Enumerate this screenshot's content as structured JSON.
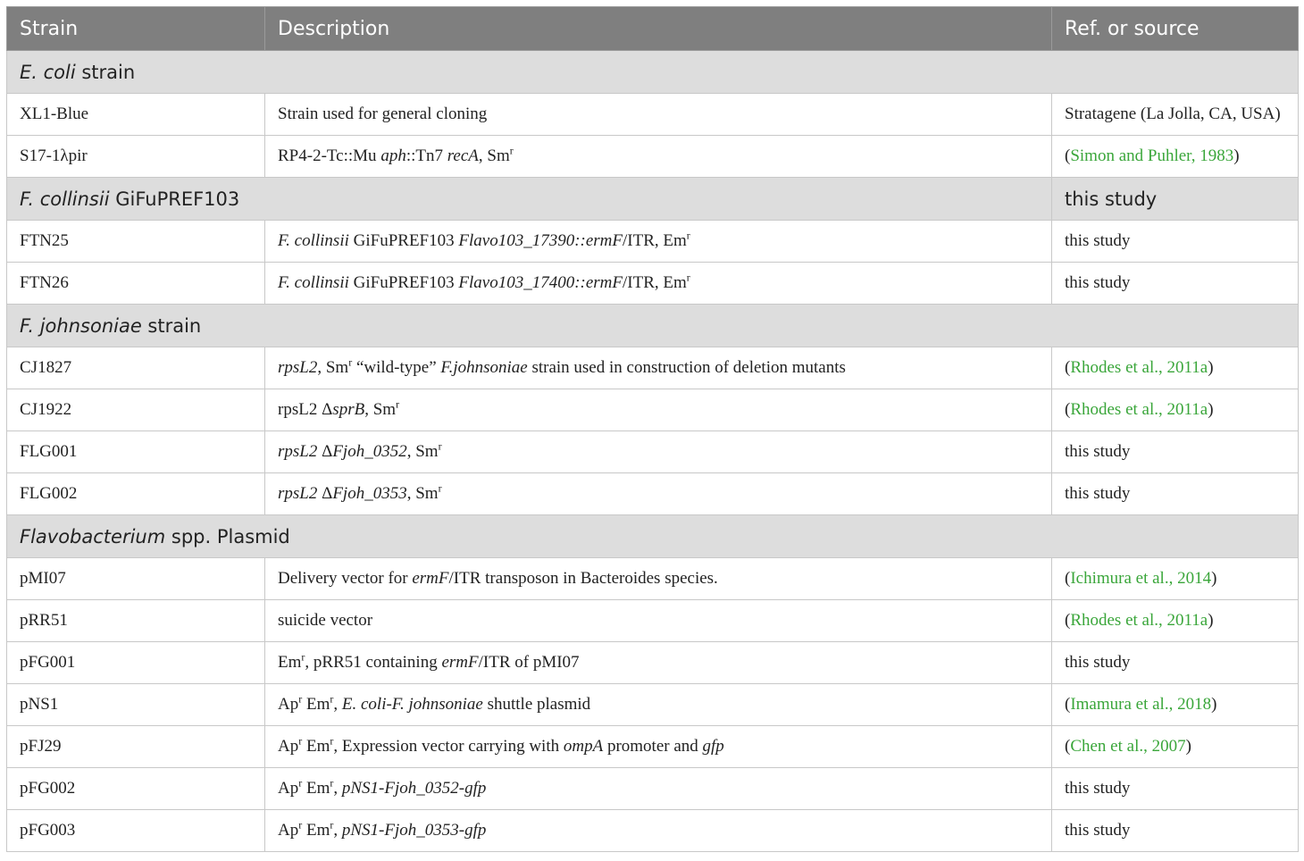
{
  "header": {
    "strain": "Strain",
    "description": "Description",
    "ref": "Ref. or source"
  },
  "sections": {
    "ecoli": {
      "italic": "E. coli",
      "rest": " strain"
    },
    "fcollinsii": {
      "italic": "F. collinsii",
      "rest": " GiFuPREF103",
      "ref": "this study"
    },
    "fjohnsoniae": {
      "italic": "F. johnsoniae",
      "rest": " strain"
    },
    "flavo": {
      "italic": "Flavobacterium",
      "rest": " spp. Plasmid"
    }
  },
  "sup_r": "r",
  "rows": {
    "xl1": {
      "strain": "XL1-Blue",
      "desc": "Strain used for general cloning",
      "ref": "Stratagene (La Jolla, CA, USA)"
    },
    "s17": {
      "strain": "S17-1λpir",
      "d1": "RP4-2-Tc::Mu ",
      "d2": "aph",
      "d3": "::Tn7 ",
      "d4": "recA",
      "d5": ", Sm",
      "ref_open": "(",
      "ref_link": "Simon and Puhler, 1983",
      "ref_close": ")"
    },
    "ftn25": {
      "strain": "FTN25",
      "d1": "F. collinsii",
      "d2": " GiFuPREF103 ",
      "d3": "Flavo103_17390::ermF",
      "d4": "/ITR, Em",
      "ref": "this study"
    },
    "ftn26": {
      "strain": "FTN26",
      "d1": "F. collinsii",
      "d2": " GiFuPREF103 ",
      "d3": "Flavo103_17400::ermF",
      "d4": "/ITR, Em",
      "ref": "this study"
    },
    "cj1827": {
      "strain": "CJ1827",
      "d1": "rpsL2",
      "d2": ", Sm",
      "d3": " “wild-type” ",
      "d4": "F.johnsoniae",
      "d5": " strain used in construction of deletion mutants",
      "ref_open": "(",
      "ref_link": "Rhodes et al., 2011a",
      "ref_close": ")"
    },
    "cj1922": {
      "strain": "CJ1922",
      "d1": "rpsL2 Δ",
      "d2": "sprB",
      "d3": ", Sm",
      "ref_open": "(",
      "ref_link": "Rhodes et al., 2011a",
      "ref_close": ")"
    },
    "flg001": {
      "strain": "FLG001",
      "d1": "rpsL2",
      "d2": " Δ",
      "d3": "Fjoh_0352",
      "d4": ", Sm",
      "ref": "this study"
    },
    "flg002": {
      "strain": "FLG002",
      "d1": "rpsL2",
      "d2": " Δ",
      "d3": "Fjoh_0353",
      "d4": ", Sm",
      "ref": "this study"
    },
    "pmi07": {
      "strain": "pMI07",
      "d1": "Delivery vector for ",
      "d2": "ermF",
      "d3": "/ITR transposon in Bacteroides species.",
      "ref_open": "(",
      "ref_link": "Ichimura et al., 2014",
      "ref_close": ")"
    },
    "prr51": {
      "strain": "pRR51",
      "desc": "suicide vector",
      "ref_open": "(",
      "ref_link": "Rhodes et al., 2011a",
      "ref_close": ")"
    },
    "pfg001": {
      "strain": "pFG001",
      "d1": "Em",
      "d2": ", pRR51 containing ",
      "d3": "ermF",
      "d4": "/ITR of pMI07",
      "ref": "this study"
    },
    "pns1": {
      "strain": "pNS1",
      "d1": "Ap",
      "d2": " Em",
      "d3": ", ",
      "d4": "E. coli-F. johnsoniae",
      "d5": " shuttle plasmid",
      "ref_open": "(",
      "ref_link": "Imamura et al., 2018",
      "ref_close": ")"
    },
    "pfj29": {
      "strain": "pFJ29",
      "d1": "Ap",
      "d2": " Em",
      "d3": ", Expression vector carrying with ",
      "d4": "ompA",
      "d5": " promoter and ",
      "d6": "gfp",
      "ref_open": "(",
      "ref_link": "Chen et al., 2007",
      "ref_close": ")"
    },
    "pfg002": {
      "strain": "pFG002",
      "d1": "Ap",
      "d2": " Em",
      "d3": ", ",
      "d4": "pNS1-Fjoh_0352-gfp",
      "ref": "this study"
    },
    "pfg003": {
      "strain": "pFG003",
      "d1": "Ap",
      "d2": " Em",
      "d3": ", ",
      "d4": "pNS1-Fjoh_0353-gfp",
      "ref": "this study"
    }
  }
}
